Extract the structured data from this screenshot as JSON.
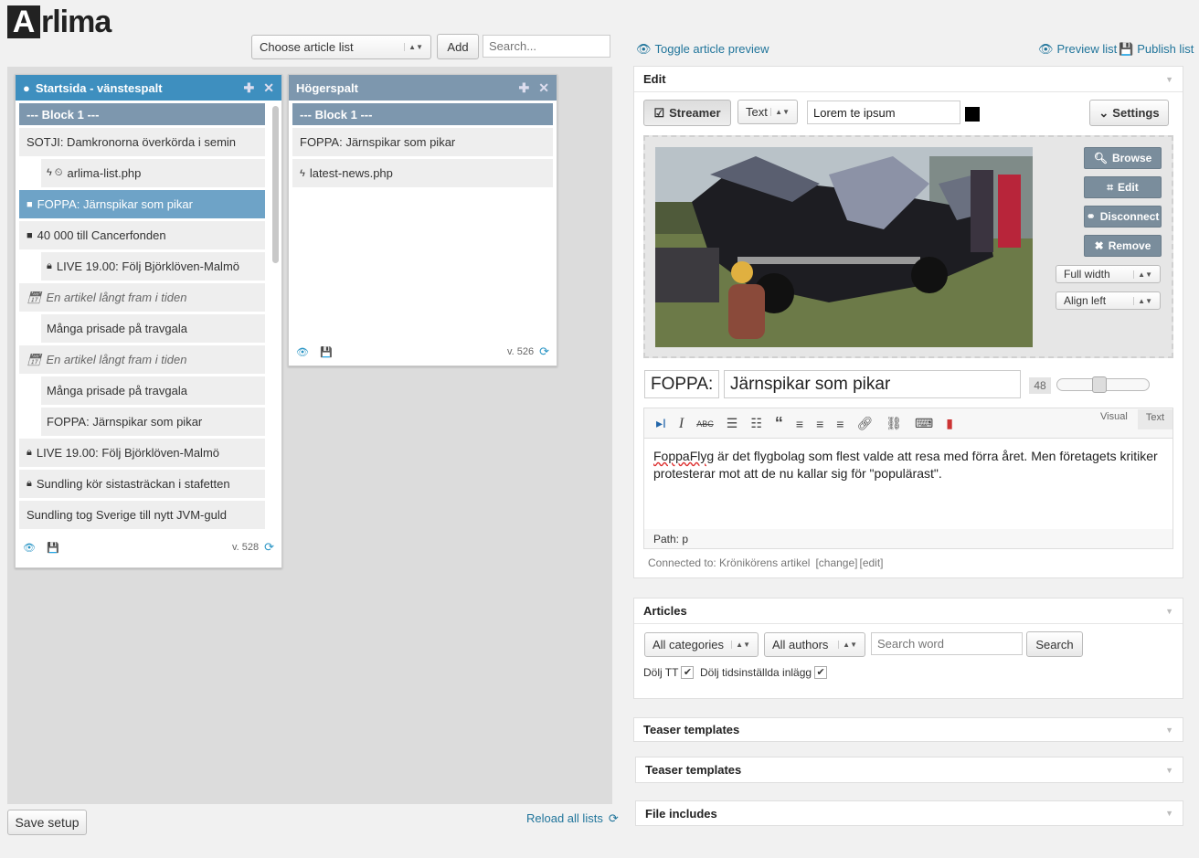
{
  "logo": {
    "first": "A",
    "rest": "rlima"
  },
  "toolbar": {
    "choose_list": "Choose article list",
    "add": "Add",
    "search_placeholder": "Search..."
  },
  "lists": [
    {
      "title": "Startsida - vänstespalt",
      "items": [
        {
          "type": "block",
          "text": "--- Block 1 ---"
        },
        {
          "type": "normal",
          "text": "SOTJI: Damkronorna överkörda i semin"
        },
        {
          "type": "ind",
          "text": "arlima-list.php",
          "icon": "bolt-clock"
        },
        {
          "type": "selected",
          "text": "FOPPA: Järnspikar som pikar"
        },
        {
          "type": "normal",
          "text": "40 000 till Cancerfonden",
          "icon": "square"
        },
        {
          "type": "ind",
          "text": "LIVE 19.00: Följ Björklöven-Malmö",
          "icon": "lock"
        },
        {
          "type": "future",
          "text": "En artikel långt fram i tiden"
        },
        {
          "type": "ind",
          "text": "Många prisade på travgala"
        },
        {
          "type": "future",
          "text": "En artikel långt fram i tiden"
        },
        {
          "type": "ind",
          "text": "Många prisade på travgala"
        },
        {
          "type": "ind",
          "text": "FOPPA: Järnspikar som pikar"
        },
        {
          "type": "normal",
          "text": "LIVE 19.00: Följ Björklöven-Malmö",
          "icon": "lock"
        },
        {
          "type": "normal",
          "text": "Sundling kör sistasträckan i stafetten",
          "icon": "lock"
        },
        {
          "type": "normal",
          "text": "Sundling tog Sverige till nytt JVM-guld"
        }
      ],
      "version": "v. 528"
    },
    {
      "title": "Högerspalt",
      "items": [
        {
          "type": "block",
          "text": "--- Block 1 ---"
        },
        {
          "type": "normal",
          "text": "FOPPA: Järnspikar som pikar"
        },
        {
          "type": "normal",
          "text": "latest-news.php",
          "icon": "bolt"
        }
      ],
      "version": "v. 526"
    }
  ],
  "bottom": {
    "save": "Save setup",
    "reload": "Reload all lists"
  },
  "right": {
    "toggle_preview": "Toggle article preview",
    "preview_list": "Preview list",
    "publish_list": "Publish list"
  },
  "edit": {
    "title": "Edit",
    "streamer": "Streamer",
    "streamer_type": "Text",
    "streamer_text": "Lorem te ipsum",
    "settings": "Settings",
    "browse": "Browse",
    "edit": "Edit",
    "disconnect": "Disconnect",
    "remove": "Remove",
    "size": "Full width",
    "align": "Align left",
    "title_prefix": "FOPPA:",
    "title_main": "Järnspikar som pikar",
    "font_size": "48",
    "tab_visual": "Visual",
    "tab_text": "Text",
    "body_link": "FoppaFlyg",
    "body": " är det flygbolag som flest valde att resa med förra året. Men företagets kritiker protesterar mot att de nu kallar sig för \"populärast\".",
    "path": "Path: p",
    "connected": "Connected to: Krönikörens artikel",
    "change": "[change]",
    "editlink": "[edit]"
  },
  "articles": {
    "title": "Articles",
    "categories": "All categories",
    "authors": "All authors",
    "search_placeholder": "Search word",
    "search": "Search",
    "hide_tt": "Dölj TT",
    "hide_scheduled": "Dölj tidsinställda inlägg"
  },
  "panels": [
    "Teaser templates",
    "Teaser templates",
    "File includes"
  ]
}
